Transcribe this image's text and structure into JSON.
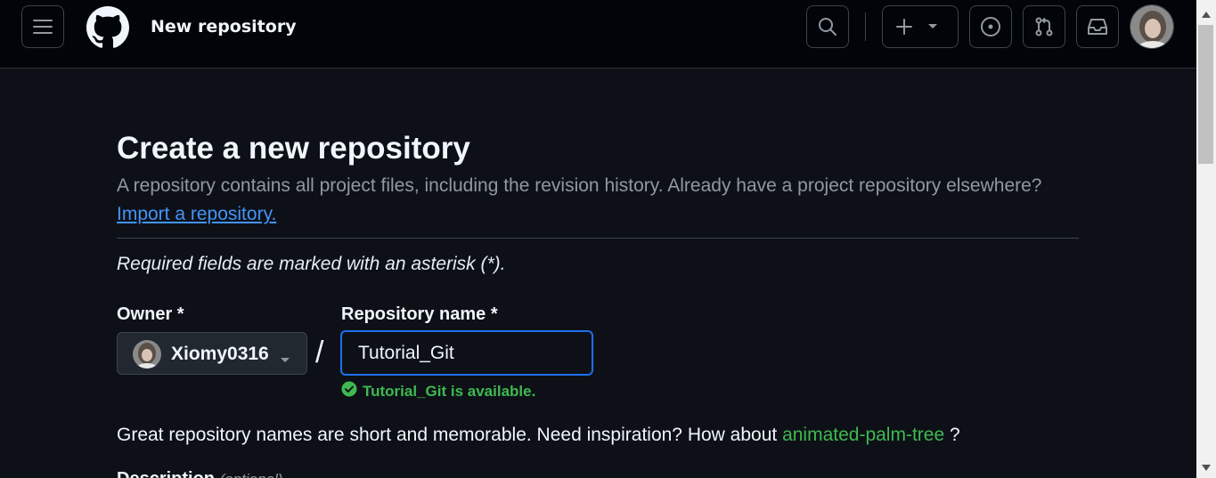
{
  "header": {
    "title": "New repository",
    "icons": [
      "menu-icon",
      "github-logo-icon",
      "search-icon",
      "plus-icon",
      "caret-down-icon",
      "issues-icon",
      "pull-request-icon",
      "inbox-icon",
      "user-avatar"
    ]
  },
  "main": {
    "page_title": "Create a new repository",
    "subtitle": "A repository contains all project files, including the revision history. Already have a project repository elsewhere?",
    "import_link": "Import a repository.",
    "required_note": "Required fields are marked with an asterisk (*).",
    "owner_label": "Owner *",
    "owner_value": "Xiomy0316",
    "slash": "/",
    "repo_label": "Repository name *",
    "repo_value": "Tutorial_Git",
    "availability": "Tutorial_Git is available.",
    "inspiration_text": "Great repository names are short and memorable. Need inspiration? How about",
    "suggestion": "animated-palm-tree",
    "suggestion_suffix": " ?",
    "description_label": "Description",
    "description_optional": "(optional)"
  },
  "colors": {
    "background": "#0d1117",
    "header_bg": "#010409",
    "link": "#4493f8",
    "success": "#3fb950",
    "focus": "#1f6feb"
  }
}
